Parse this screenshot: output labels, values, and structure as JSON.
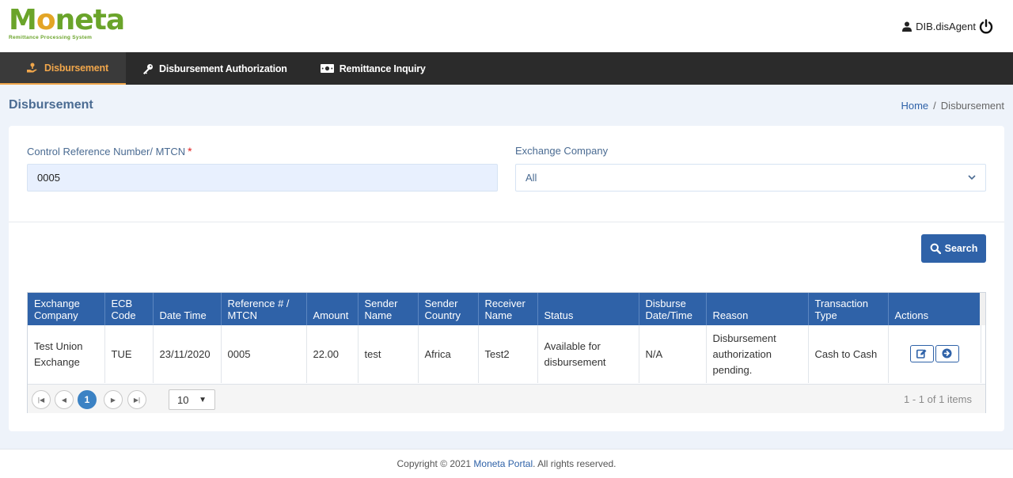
{
  "brand": {
    "name_m": "M",
    "name_o": "o",
    "name_rest": "neta",
    "tagline": "Remittance Processing System"
  },
  "user": {
    "name": "DIB.disAgent"
  },
  "nav": [
    {
      "label": "Disbursement",
      "icon": "hand-coin-icon",
      "active": true
    },
    {
      "label": "Disbursement Authorization",
      "icon": "key-icon",
      "active": false
    },
    {
      "label": "Remittance Inquiry",
      "icon": "money-icon",
      "active": false
    }
  ],
  "page": {
    "title": "Disbursement",
    "breadcrumb": {
      "home": "Home",
      "sep": "/",
      "current": "Disbursement"
    }
  },
  "form": {
    "ref_label": "Control Reference Number/ MTCN",
    "required_mark": "*",
    "ref_value": "0005",
    "exchange_label": "Exchange Company",
    "exchange_value": "All",
    "search_label": "Search"
  },
  "table": {
    "columns": [
      "Exchange Company",
      "ECB Code",
      "Date Time",
      "Reference # / MTCN",
      "Amount",
      "Sender Name",
      "Sender Country",
      "Receiver Name",
      "Status",
      "Disburse Date/Time",
      "Reason",
      "Transaction Type",
      "Actions"
    ],
    "rows": [
      [
        "Test Union Exchange",
        "TUE",
        "23/11/2020",
        "0005",
        "22.00",
        "test",
        "Africa",
        "Test2",
        "Available for disbursement",
        "N/A",
        "Disbursement authorization pending.",
        "Cash to Cash"
      ]
    ]
  },
  "pager": {
    "current_page": "1",
    "page_size": "10",
    "info": "1 - 1 of 1 items"
  },
  "footer": {
    "prefix": "Copyright © 2021",
    "brand": "Moneta Portal",
    "suffix": ". All rights reserved."
  },
  "colors": {
    "primary": "#2f62a8",
    "nav_bg": "#2b2b2b",
    "active_accent": "#f0a64b",
    "brand_green": "#6aa42a",
    "brand_orange": "#e3a526"
  }
}
